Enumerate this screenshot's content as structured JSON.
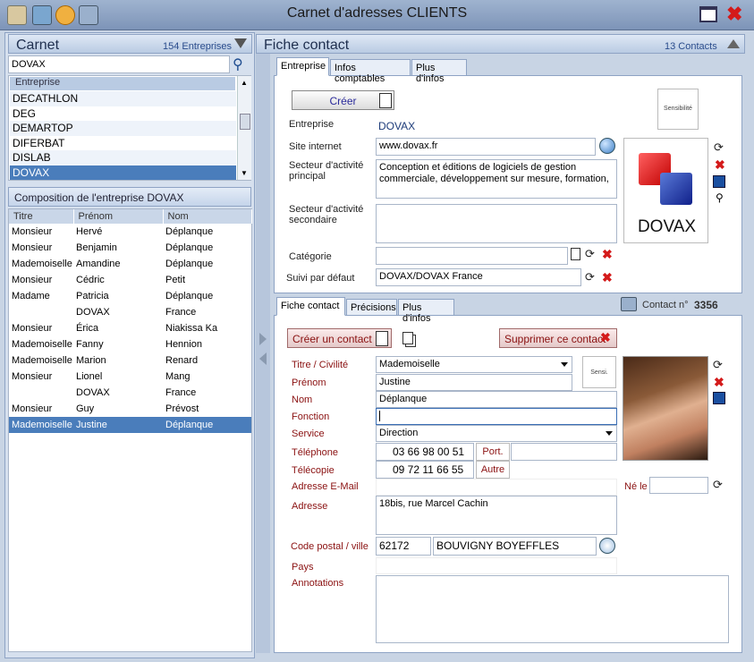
{
  "window": {
    "title": "Carnet d'adresses CLIENTS"
  },
  "carnet": {
    "title": "Carnet",
    "count": "154 Entreprises",
    "search_value": "DOVAX",
    "list_header": "Entreprise",
    "companies": [
      "DECATHLON",
      "DEG",
      "DEMARTOP",
      "DIFERBAT",
      "DISLAB",
      "DOVAX"
    ],
    "selected_company": "DOVAX"
  },
  "composition": {
    "title": "Composition de l'entreprise DOVAX",
    "headers": [
      "Titre",
      "Prénom",
      "Nom"
    ],
    "rows": [
      [
        "Monsieur",
        "Hervé",
        "Déplanque"
      ],
      [
        "Monsieur",
        "Benjamin",
        "Déplanque"
      ],
      [
        "Mademoiselle",
        "Amandine",
        "Déplanque"
      ],
      [
        "Monsieur",
        "Cédric",
        "Petit"
      ],
      [
        "Madame",
        "Patricia",
        "Déplanque"
      ],
      [
        "",
        "DOVAX",
        "France"
      ],
      [
        "Monsieur",
        "Érica",
        "Niakissa Ka"
      ],
      [
        "Mademoiselle",
        "Fanny",
        "Hennion"
      ],
      [
        "Mademoiselle",
        "Marion",
        "Renard"
      ],
      [
        "Monsieur",
        "Lionel",
        "Mang"
      ],
      [
        "",
        "DOVAX",
        "France"
      ],
      [
        "Monsieur",
        "Guy",
        "Prévost"
      ],
      [
        "Mademoiselle",
        "Justine",
        "Déplanque"
      ]
    ],
    "selected_index": 12
  },
  "fiche": {
    "title": "Fiche contact",
    "count": "13 Contacts",
    "tabs": [
      "Entreprise",
      "Infos comptables",
      "Plus d'infos"
    ],
    "create_label": "Créer",
    "sensibilite": "Sensibilité",
    "entreprise_label": "Entreprise",
    "entreprise_value": "DOVAX",
    "site_label": "Site internet",
    "site_value": "www.dovax.fr",
    "secteur_principal_label": "Secteur d'activité principal",
    "secteur_principal_value": "Conception et éditions de logiciels de gestion commerciale, développement sur mesure, formation,",
    "secteur_secondaire_label": "Secteur d'activité secondaire",
    "categorie_label": "Catégorie",
    "suivi_label": "Suivi par défaut",
    "suivi_value": "DOVAX/DOVAX France",
    "logo_text": "DOVAX"
  },
  "contact": {
    "tabs": [
      "Fiche contact",
      "Précisions",
      "Plus d'infos"
    ],
    "contact_no_label": "Contact n°",
    "contact_no": "3356",
    "create_label": "Créer un contact",
    "delete_label": "Supprimer ce contact",
    "titre_label": "Titre / Civilité",
    "titre_value": "Mademoiselle",
    "sensi_label": "Sensi.",
    "prenom_label": "Prénom",
    "prenom_value": "Justine",
    "nom_label": "Nom",
    "nom_value": "Déplanque",
    "fonction_label": "Fonction",
    "service_label": "Service",
    "service_value": "Direction",
    "telephone_label": "Téléphone",
    "telephone_value": "03 66 98 00 51",
    "port_label": "Port.",
    "telecopie_label": "Télécopie",
    "telecopie_value": "09 72 11 66 55",
    "autre_label": "Autre",
    "email_label": "Adresse E-Mail",
    "ne_le_label": "Né le",
    "adresse_label": "Adresse",
    "adresse_value": "18bis, rue Marcel Cachin",
    "cp_label": "Code postal / ville",
    "cp_value": "62172",
    "ville_value": "BOUVIGNY BOYEFFLES",
    "pays_label": "Pays",
    "annotations_label": "Annotations"
  },
  "colors": {
    "accent": "#4a7dbb",
    "header": "#b9cbe3",
    "delete": "#d41a1a",
    "label_red": "#8a1010"
  }
}
